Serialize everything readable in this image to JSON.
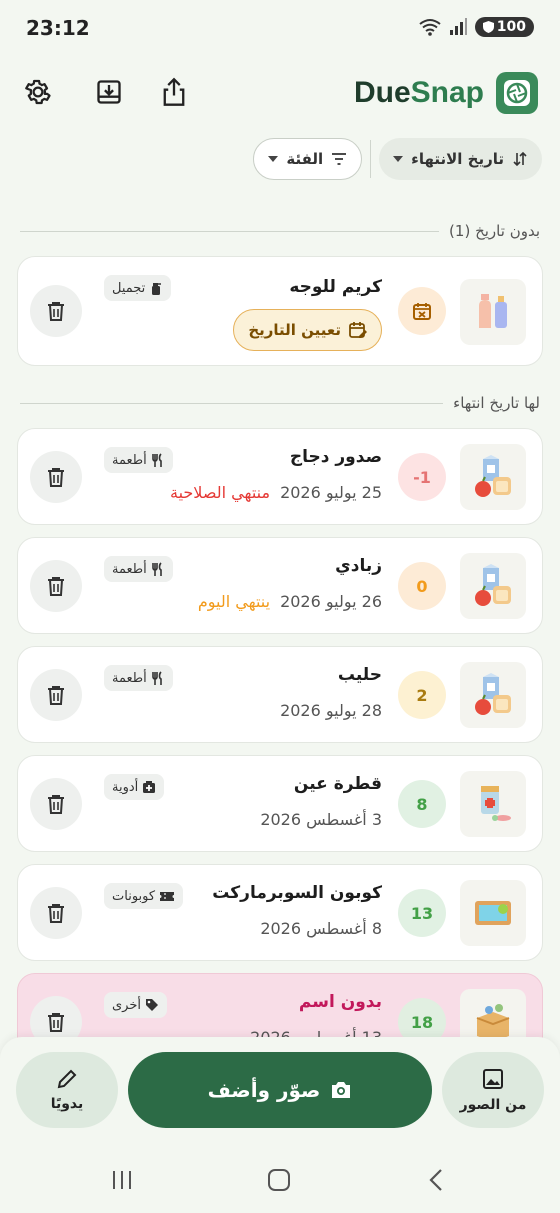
{
  "status": {
    "time": "23:12",
    "battery": "100"
  },
  "app": {
    "brand_due": "Due",
    "brand_snap": "Snap"
  },
  "filters": {
    "sort_label": "تاريخ الانتهاء",
    "category_label": "الفئة"
  },
  "sections": {
    "no_date": "بدون تاريخ (1)",
    "with_date": "لها تاريخ انتهاء"
  },
  "no_date_items": [
    {
      "name": "كريم للوجه",
      "category": "تجميل",
      "action": "تعيين التاريخ",
      "thumb_icon": "cosmetics-icon"
    }
  ],
  "items": [
    {
      "name": "صدور دجاج",
      "date": "25 يوليو 2026",
      "status": "منتهي الصلاحية",
      "status_color": "#e53935",
      "days": "-1",
      "badge_bg": "#fde3e3",
      "badge_fg": "#e57373",
      "category": "أطعمة",
      "thumb_icon": "food-icon"
    },
    {
      "name": "زبادي",
      "date": "26 يوليو 2026",
      "status": "ينتهي اليوم",
      "status_color": "#f29b1c",
      "days": "0",
      "badge_bg": "#fdebd6",
      "badge_fg": "#f29b1c",
      "category": "أطعمة",
      "thumb_icon": "food-icon"
    },
    {
      "name": "حليب",
      "date": "28 يوليو 2026",
      "status": "",
      "days": "2",
      "badge_bg": "#fdf1d2",
      "badge_fg": "#a97b10",
      "category": "أطعمة",
      "thumb_icon": "food-icon"
    },
    {
      "name": "قطرة عين",
      "date": "3 أغسطس 2026",
      "status": "",
      "days": "8",
      "badge_bg": "#e1f1e3",
      "badge_fg": "#43a047",
      "category": "أدوية",
      "thumb_icon": "medicine-icon"
    },
    {
      "name": "كوبون السوبرماركت",
      "date": "8 أغسطس 2026",
      "status": "",
      "days": "13",
      "badge_bg": "#e1f1e3",
      "badge_fg": "#43a047",
      "category": "كوبونات",
      "thumb_icon": "coupon-icon"
    },
    {
      "name": "بدون اسم",
      "date": "13 أغسطس 2026",
      "status": "",
      "days": "18",
      "badge_bg": "#e1efe1",
      "badge_fg": "#43a047",
      "category": "أخرى",
      "thumb_icon": "box-icon"
    }
  ],
  "bottom": {
    "gallery_label": "من الصور",
    "capture_label": "صوّر وأضف",
    "manual_label": "يدويًا"
  },
  "colors": {
    "primary": "#2c6b46",
    "background": "#f3f7f1",
    "name_pink": "#c2185b"
  }
}
